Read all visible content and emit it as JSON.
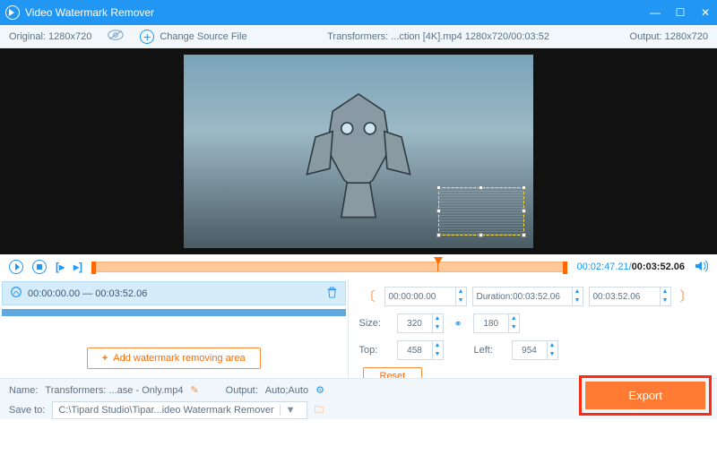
{
  "window": {
    "title": "Video Watermark Remover"
  },
  "infobar": {
    "original": "Original: 1280x720",
    "change_source": "Change Source File",
    "file_label": "Transformers: ...ction [4K].mp4   1280x720/00:03:52",
    "output": "Output: 1280x720"
  },
  "transport": {
    "pos": "00:02:47.21",
    "dur": "00:03:52.06"
  },
  "segment": {
    "range": "00:00:00.00 — 00:03:52.06"
  },
  "add_button": "Add watermark removing area",
  "clip": {
    "start": "00:00:00.00",
    "dur_label": "Duration:00:03:52.06",
    "end": "00:03:52.06",
    "size_label": "Size:",
    "w": "320",
    "h": "180",
    "top_label": "Top:",
    "top": "458",
    "left_label": "Left:",
    "left": "954",
    "reset": "Reset"
  },
  "footer": {
    "name_label": "Name:",
    "name": "Transformers: ...ase - Only.mp4",
    "output_label": "Output:",
    "output": "Auto;Auto",
    "save_label": "Save to:",
    "save_path": "C:\\Tipard Studio\\Tipar...ideo Watermark Remover",
    "export": "Export"
  }
}
